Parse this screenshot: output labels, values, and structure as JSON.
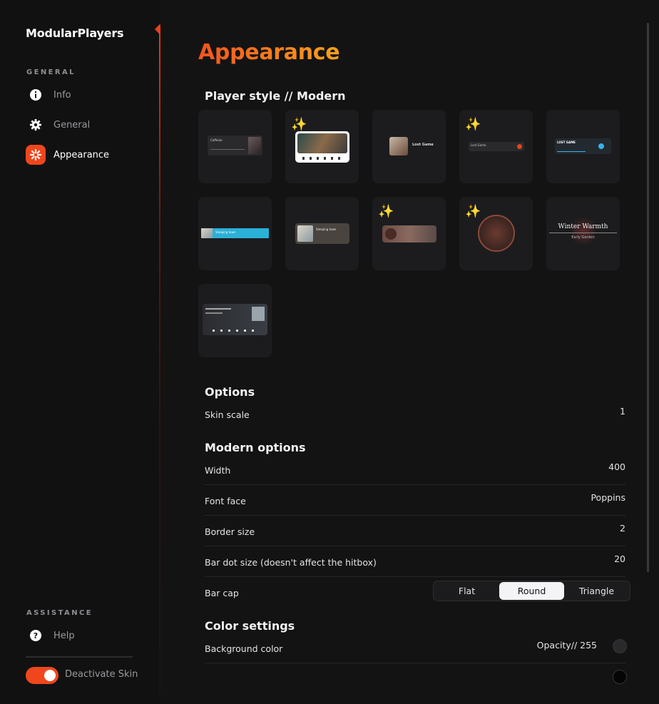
{
  "app": {
    "name": "ModularPlayers"
  },
  "sidebar": {
    "general_label": "GENERAL",
    "items": [
      {
        "label": "Info",
        "icon": "info-icon"
      },
      {
        "label": "General",
        "icon": "gear-icon"
      },
      {
        "label": "Appearance",
        "icon": "appearance-icon"
      }
    ],
    "assistance_label": "ASSISTANCE",
    "help_label": "Help",
    "toggle_label": "Deactivate Skin"
  },
  "main": {
    "title": "Appearance",
    "player_style_heading": "Player style // Modern",
    "tiles": [
      {
        "text": "Caffeine",
        "wand": false
      },
      {
        "text": "",
        "wand": true
      },
      {
        "text": "Lost Game",
        "wand": false
      },
      {
        "text": "Lost Game",
        "wand": true
      },
      {
        "text": "LOST GAME",
        "wand": false
      },
      {
        "text": "Sleeping town",
        "wand": false
      },
      {
        "text": "Sleeping town",
        "wand": false
      },
      {
        "text": "",
        "wand": true
      },
      {
        "text": "",
        "wand": true
      },
      {
        "text": "Winter Warmth",
        "subtext": "Early Garden",
        "wand": false
      },
      {
        "text": "",
        "wand": false
      }
    ],
    "options_heading": "Options",
    "skin_scale": {
      "label": "Skin scale",
      "value": "1"
    },
    "modern_heading": "Modern options",
    "modern_rows": [
      {
        "label": "Width",
        "value": "400"
      },
      {
        "label": "Font face",
        "value": "Poppins"
      },
      {
        "label": "Border size",
        "value": "2"
      },
      {
        "label": "Bar dot size (doesn't affect the hitbox)",
        "value": "20"
      }
    ],
    "bar_cap": {
      "label": "Bar cap",
      "options": [
        "Flat",
        "Round",
        "Triangle"
      ],
      "selected": "Round"
    },
    "color_heading": "Color settings",
    "background_color": {
      "label": "Background color",
      "value": "Opacity// 255"
    }
  },
  "colors": {
    "accent": "#f0461e",
    "title_start": "#f2541e",
    "title_end": "#f7a21c"
  }
}
